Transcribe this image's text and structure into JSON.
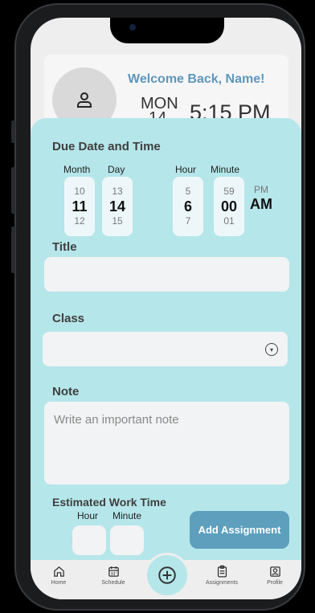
{
  "header": {
    "welcome": "Welcome Back, Name!",
    "day": "MON",
    "date": "14",
    "time": "5:15 PM"
  },
  "due": {
    "title": "Due Date and Time",
    "month_label": "Month",
    "day_label": "Day",
    "hour_label": "Hour",
    "minute_label": "Minute",
    "month": {
      "prev": "10",
      "current": "11",
      "next": "12"
    },
    "day": {
      "prev": "13",
      "current": "14",
      "next": "15"
    },
    "hour": {
      "prev": "5",
      "current": "6",
      "next": "7"
    },
    "minute": {
      "prev": "59",
      "current": "00",
      "next": "01"
    },
    "ampm": {
      "prev": "PM",
      "current": "AM"
    }
  },
  "title_field": {
    "label": "Title",
    "value": ""
  },
  "class_field": {
    "label": "Class",
    "value": ""
  },
  "note_field": {
    "label": "Note",
    "placeholder": "Write an important note"
  },
  "work_time": {
    "label": "Estimated Work Time",
    "hour_label": "Hour",
    "minute_label": "Minute",
    "hour_value": "",
    "minute_value": ""
  },
  "add_button": "Add Assignment",
  "nav": {
    "home": "Home",
    "schedule": "Schedule",
    "assignments": "Assignments",
    "profile": "Profile"
  },
  "colors": {
    "teal_sheet": "#b5e6ea",
    "accent_blue": "#5d97bd",
    "button_blue": "#5d9fbd"
  }
}
